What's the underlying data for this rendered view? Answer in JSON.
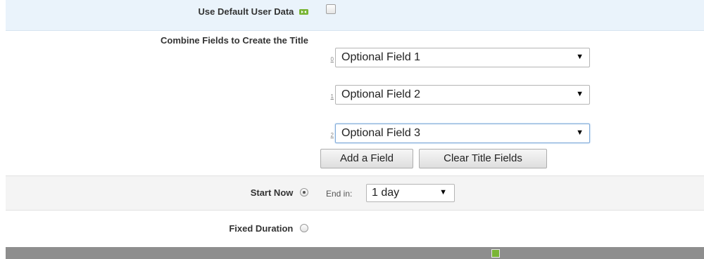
{
  "default_user_data": {
    "label": "Use Default User Data",
    "checked": false
  },
  "title_fields": {
    "label": "Combine Fields to Create the Title",
    "fields": [
      {
        "index": "0",
        "value": "Optional Field 1"
      },
      {
        "index": "1",
        "value": "Optional Field 2"
      },
      {
        "index": "2",
        "value": "Optional Field 3"
      }
    ],
    "add_button": "Add a Field",
    "clear_button": "Clear Title Fields"
  },
  "start_now": {
    "label": "Start Now",
    "selected": true,
    "end_label": "End in:",
    "end_value": "1 day"
  },
  "fixed_duration": {
    "label": "Fixed Duration",
    "selected": false
  },
  "footer": {
    "title": "",
    "accent_color": "#7ab536"
  }
}
